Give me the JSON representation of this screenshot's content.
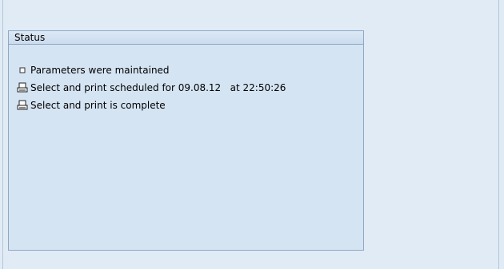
{
  "status_panel": {
    "title": "Status",
    "items": [
      {
        "icon": "bullet-square-icon",
        "text": "Parameters were maintained"
      },
      {
        "icon": "printer-icon",
        "text": "Select and print scheduled for 09.08.12   at 22:50:26"
      },
      {
        "icon": "printer-icon",
        "text": "Select and print is complete"
      }
    ]
  }
}
